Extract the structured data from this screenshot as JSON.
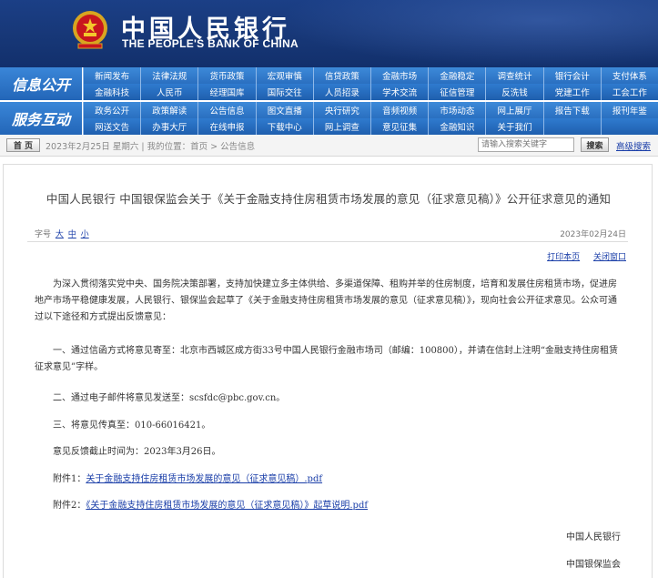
{
  "header": {
    "logo_cn": "中国人民银行",
    "logo_en": "THE PEOPLE'S BANK OF CHINA",
    "colors": {
      "banner": "#173777",
      "nav": "#2f7bcf",
      "link": "#1a3ea8"
    }
  },
  "nav": {
    "group1_label": "信息公开",
    "group2_label": "服务互动",
    "row1": [
      "新闻发布",
      "法律法规",
      "货币政策",
      "宏观审慎",
      "信贷政策",
      "金融市场",
      "金融稳定",
      "调查统计",
      "银行会计",
      "支付体系"
    ],
    "row2": [
      "金融科技",
      "人民币",
      "经理国库",
      "国际交往",
      "人员招录",
      "学术交流",
      "征信管理",
      "反洗钱",
      "党建工作",
      "工会工作"
    ],
    "row3": [
      "政务公开",
      "政策解读",
      "公告信息",
      "图文直播",
      "央行研究",
      "音频视频",
      "市场动态",
      "网上展厅",
      "报告下载",
      "报刊年鉴"
    ],
    "row4": [
      "网送文告",
      "办事大厅",
      "在线申报",
      "下载中心",
      "网上调查",
      "意见征集",
      "金融知识",
      "关于我们",
      "",
      ""
    ]
  },
  "crumbbar": {
    "home": "首 页",
    "trail": "2023年2月25日  星期六  |  我的位置：首页  >  公告信息",
    "search_placeholder": "请输入搜索关键字",
    "search_button": "搜索",
    "advanced_search": "高级搜索"
  },
  "article": {
    "title": "中国人民银行  中国银保监会关于《关于金融支持住房租赁市场发展的意见（征求意见稿）》公开征求意见的通知",
    "font_size_label": "字号",
    "font_large": "大",
    "font_medium": "中",
    "font_small": "小",
    "date": "2023年02月24日",
    "print": "打印本页",
    "close": "关闭窗口",
    "p1": "为深入贯彻落实党中央、国务院决策部署，支持加快建立多主体供给、多渠道保障、租购并举的住房制度，培育和发展住房租赁市场，促进房地产市场平稳健康发展，人民银行、银保监会起草了《关于金融支持住房租赁市场发展的意见（征求意见稿）》，现向社会公开征求意见。公众可通过以下途径和方式提出反馈意见：",
    "p2": "一、通过信函方式将意见寄至：北京市西城区成方街33号中国人民银行金融市场司（邮编：100800），并请在信封上注明“金融支持住房租赁征求意见”字样。",
    "p3": "二、通过电子邮件将意见发送至：scsfdc@pbc.gov.cn。",
    "p4": "三、将意见传真至：010-66016421。",
    "p5": "意见反馈截止时间为：2023年3月26日。",
    "attach1_label": "附件1：",
    "attach1_link": "关于金融支持住房租赁市场发展的意见（征求意见稿）.pdf",
    "attach2_label": "附件2：",
    "attach2_link": "《关于金融支持住房租赁市场发展的意见（征求意见稿）》起草说明.pdf",
    "sign1": "中国人民银行",
    "sign2": "中国银保监会"
  }
}
